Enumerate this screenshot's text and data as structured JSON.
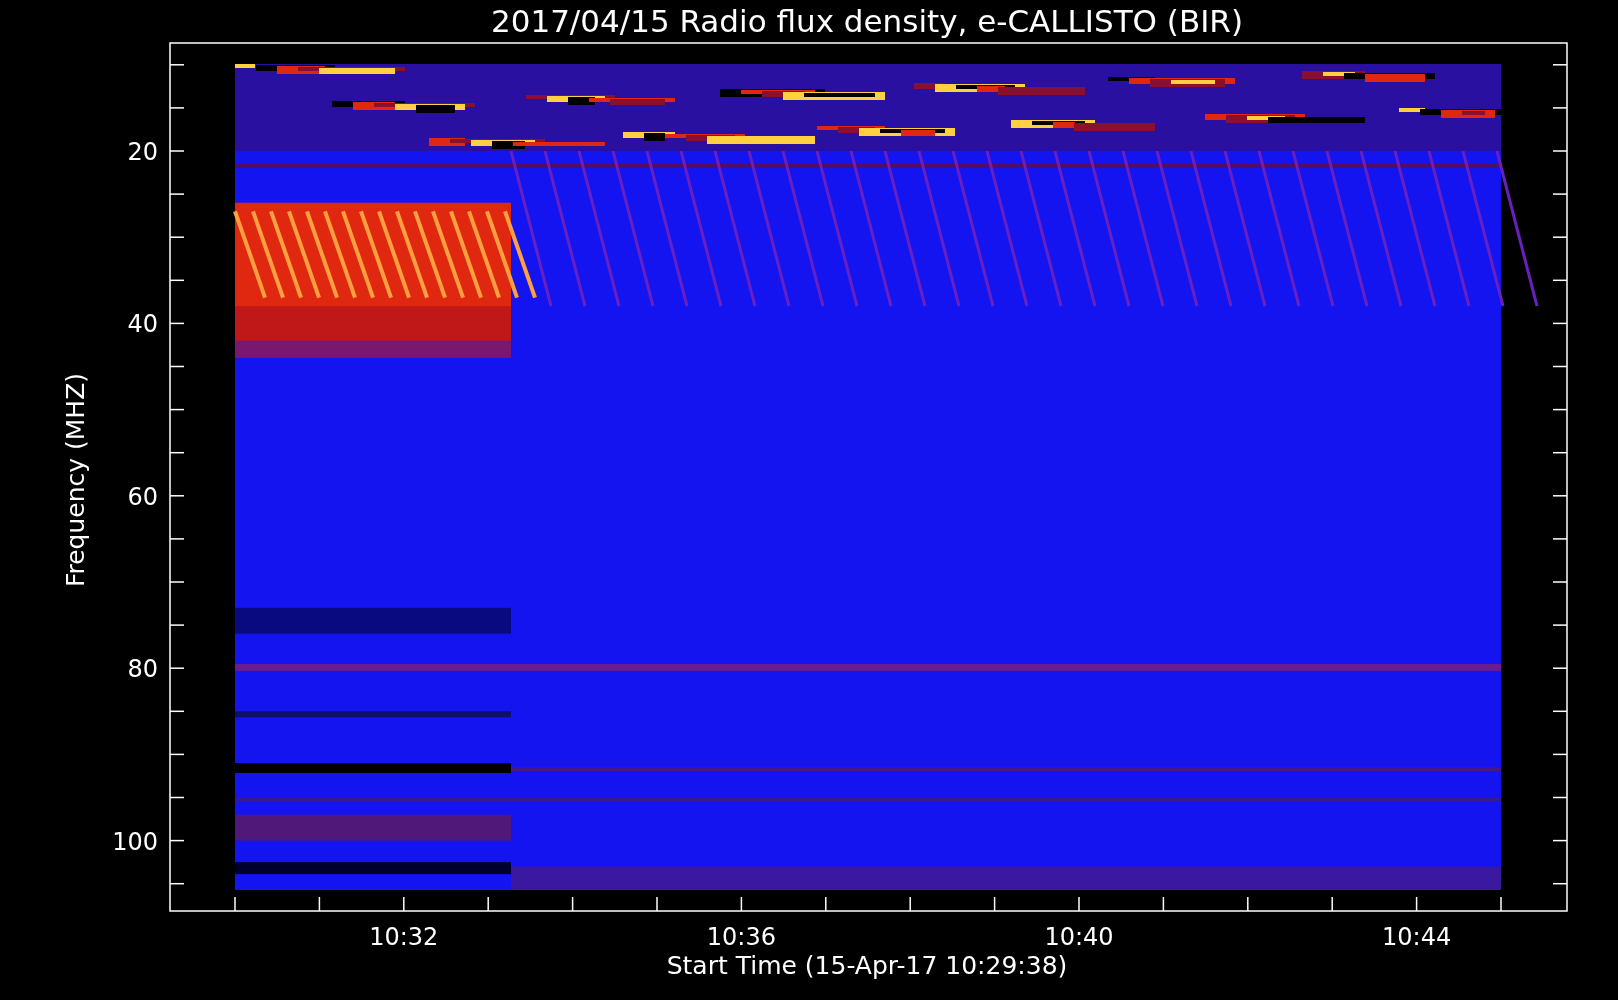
{
  "plot": {
    "title": "2017/04/15  Radio flux density, e-CALLISTO (BIR)",
    "ylabel": "Frequency (MHZ)",
    "xlabel": "Start Time (15-Apr-17 10:29:38)",
    "yticks": [
      "20",
      "40",
      "60",
      "80",
      "100"
    ],
    "xticks": [
      "10:32",
      "10:36",
      "10:40",
      "10:44"
    ]
  }
}
